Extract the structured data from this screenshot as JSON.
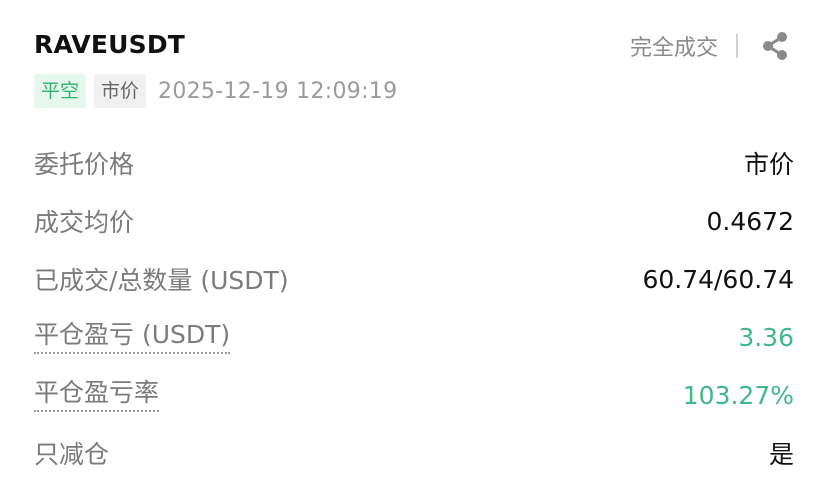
{
  "header": {
    "symbol": "RAVEUSDT",
    "status": "完全成交"
  },
  "tags": {
    "side": "平空",
    "order_type": "市价",
    "timestamp": "2025-12-19 12:09:19"
  },
  "details": [
    {
      "label": "委托价格",
      "value": "市价"
    },
    {
      "label": "成交均价",
      "value": "0.4672"
    },
    {
      "label": "已成交/总数量 (USDT)",
      "value": "60.74/60.74"
    },
    {
      "label": "平仓盈亏 (USDT)",
      "value": "3.36"
    },
    {
      "label": "平仓盈亏率",
      "value": "103.27%"
    },
    {
      "label": "只减仓",
      "value": "是"
    }
  ],
  "colors": {
    "positive": "#3fb98a",
    "side_tag_bg": "#e6f7ee",
    "side_tag_text": "#2fb36e"
  },
  "icons": {
    "share": "share-icon"
  }
}
